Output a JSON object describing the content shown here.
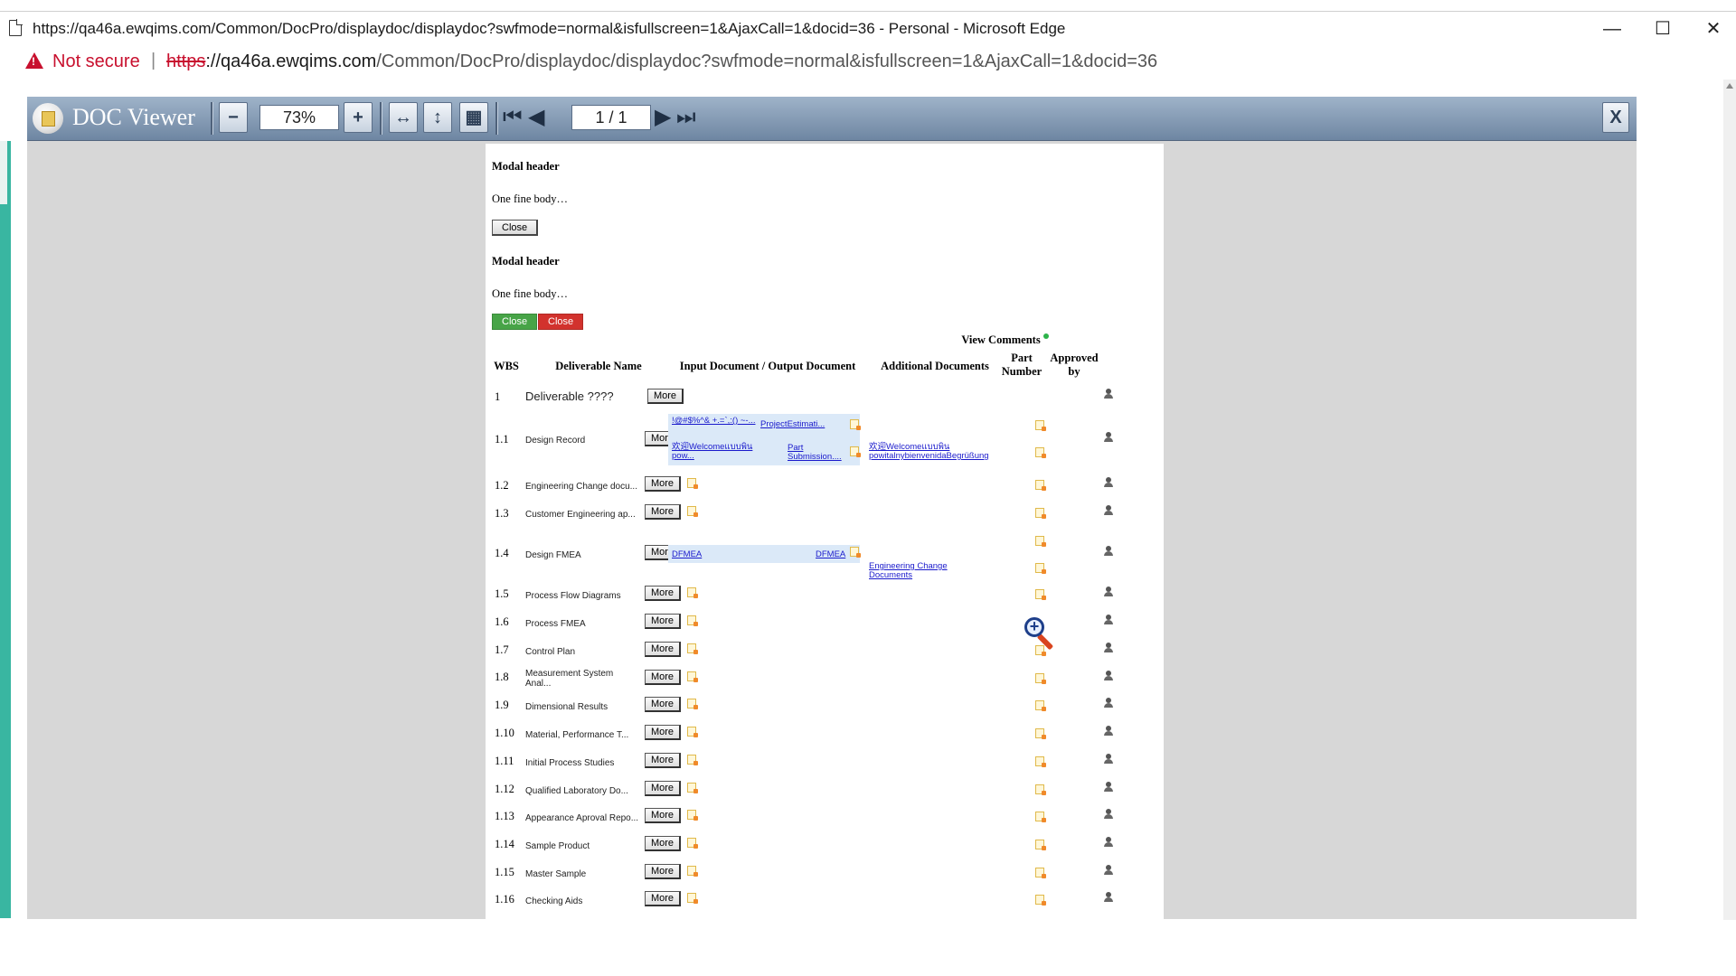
{
  "window": {
    "title": "https://qa46a.ewqims.com/Common/DocPro/displaydoc/displaydoc?swfmode=normal&isfullscreen=1&AjaxCall=1&docid=36 - Personal - Microsoft Edge",
    "minimize": "—",
    "maximize": "☐",
    "close": "✕"
  },
  "address": {
    "security": "Not secure",
    "separator": "|",
    "scheme": "https",
    "host": "://qa46a.ewqims.com",
    "path": "/Common/DocPro/displaydoc/displaydoc?swfmode=normal&isfullscreen=1&AjaxCall=1&docid=36"
  },
  "viewer": {
    "app_name": "DOC Viewer",
    "zoom": "73%",
    "page": "1 / 1",
    "close_label": "X"
  },
  "doc": {
    "modal1_header": "Modal header",
    "modal1_body": "One fine body…",
    "modal1_close": "Close",
    "modal2_header": "Modal header",
    "modal2_body": "One fine body…",
    "modal2_close_green": "Close",
    "modal2_close_red": "Close",
    "view_comments": "View Comments",
    "headers": {
      "wbs": "WBS",
      "deliverable": "Deliverable Name",
      "io_doc": "Input Document / Output Document",
      "additional": "Additional Documents",
      "part_number": "Part Number",
      "approved_by": "Approved by"
    },
    "more_label": "More",
    "rows": [
      {
        "wbs": "1",
        "name": "Deliverable ????"
      },
      {
        "wbs": "1.1",
        "name": "Design Record"
      },
      {
        "wbs": "1.2",
        "name": "Engineering Change docu..."
      },
      {
        "wbs": "1.3",
        "name": "Customer Engineering ap..."
      },
      {
        "wbs": "1.4",
        "name": "Design FMEA"
      },
      {
        "wbs": "1.5",
        "name": "Process Flow Diagrams"
      },
      {
        "wbs": "1.6",
        "name": "Process FMEA"
      },
      {
        "wbs": "1.7",
        "name": "Control Plan"
      },
      {
        "wbs": "1.8",
        "name": "Measurement System Anal..."
      },
      {
        "wbs": "1.9",
        "name": "Dimensional Results"
      },
      {
        "wbs": "1.10",
        "name": "Material, Performance T..."
      },
      {
        "wbs": "1.11",
        "name": "Initial Process Studies"
      },
      {
        "wbs": "1.12",
        "name": "Qualified Laboratory Do..."
      },
      {
        "wbs": "1.13",
        "name": "Appearance Aproval Repo..."
      },
      {
        "wbs": "1.14",
        "name": "Sample Product"
      },
      {
        "wbs": "1.15",
        "name": "Master Sample"
      },
      {
        "wbs": "1.16",
        "name": "Checking Aids"
      }
    ],
    "links": {
      "r11_in1": "!@#$%^& +.=`,:() ~-...",
      "r11_out1": "ProjectEstimati...",
      "r11_in2": "欢迎Welcomeแบบพิน pow...",
      "r11_out2": "Part Submission....",
      "r11_add": "欢迎Welcomeแบบพิน powitalnybienvenidaBegrüßung",
      "r14_in": "DFMEA",
      "r14_out": "DFMEA",
      "r14_add": "Engineering Change Documents"
    }
  }
}
